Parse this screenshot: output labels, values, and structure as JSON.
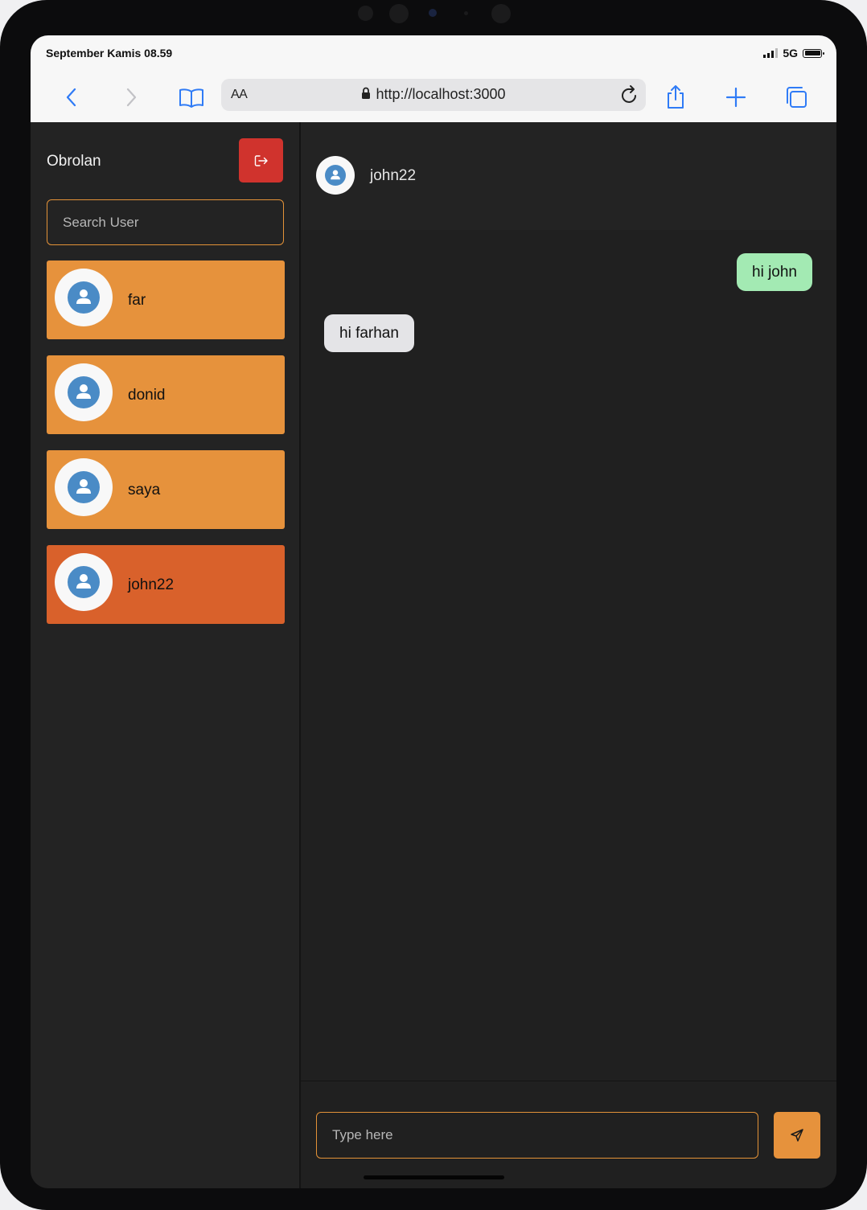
{
  "status_bar": {
    "time": "September Kamis 08.59",
    "network": "5G"
  },
  "browser": {
    "text_size_label": "AA",
    "url": "http://localhost:3000",
    "icons": [
      "back-icon",
      "forward-icon",
      "bookmarks-icon",
      "lock-icon",
      "reload-icon",
      "share-icon",
      "new-tab-icon",
      "tabs-icon"
    ],
    "accent": "#2f7bf6"
  },
  "sidebar": {
    "title": "Obrolan",
    "logout_icon": "logout-icon",
    "search_placeholder": "Search User",
    "users": [
      {
        "name": "far",
        "active": false
      },
      {
        "name": "donid",
        "active": false
      },
      {
        "name": "saya",
        "active": false
      },
      {
        "name": "john22",
        "active": true
      }
    ]
  },
  "chat": {
    "contact_name": "john22",
    "messages": [
      {
        "text": "hi john",
        "direction": "out"
      },
      {
        "text": "hi farhan",
        "direction": "in"
      }
    ],
    "input_placeholder": "Type here",
    "send_icon": "send-icon"
  },
  "colors": {
    "user_item": "#e6923c",
    "user_item_active": "#d9612b",
    "logout": "#d0332d",
    "outgoing_bubble": "#a3eab3",
    "incoming_bubble": "#e4e4e7",
    "border_accent": "#e39238"
  }
}
